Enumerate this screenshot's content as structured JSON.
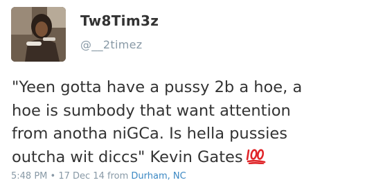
{
  "user": {
    "display_name": "Tw8Tim3z",
    "handle": "@__2timez"
  },
  "tweet": {
    "lines": [
      "\"Yeen gotta have a pussy 2b a hoe, a",
      "hoe is sumbody that want attention",
      "from anotha niGCa. Is hella pussies",
      "outcha wit diccs\" Kevin Gates"
    ],
    "emoji": "hundred-points-icon"
  },
  "meta": {
    "time": "5:48 PM",
    "separator": "•",
    "date": "17 Dec 14",
    "from_label": "from",
    "location": "Durham, NC"
  },
  "colors": {
    "text": "#333333",
    "muted": "#8899a6",
    "link": "#3b88c3",
    "emoji": "#e0262a"
  }
}
